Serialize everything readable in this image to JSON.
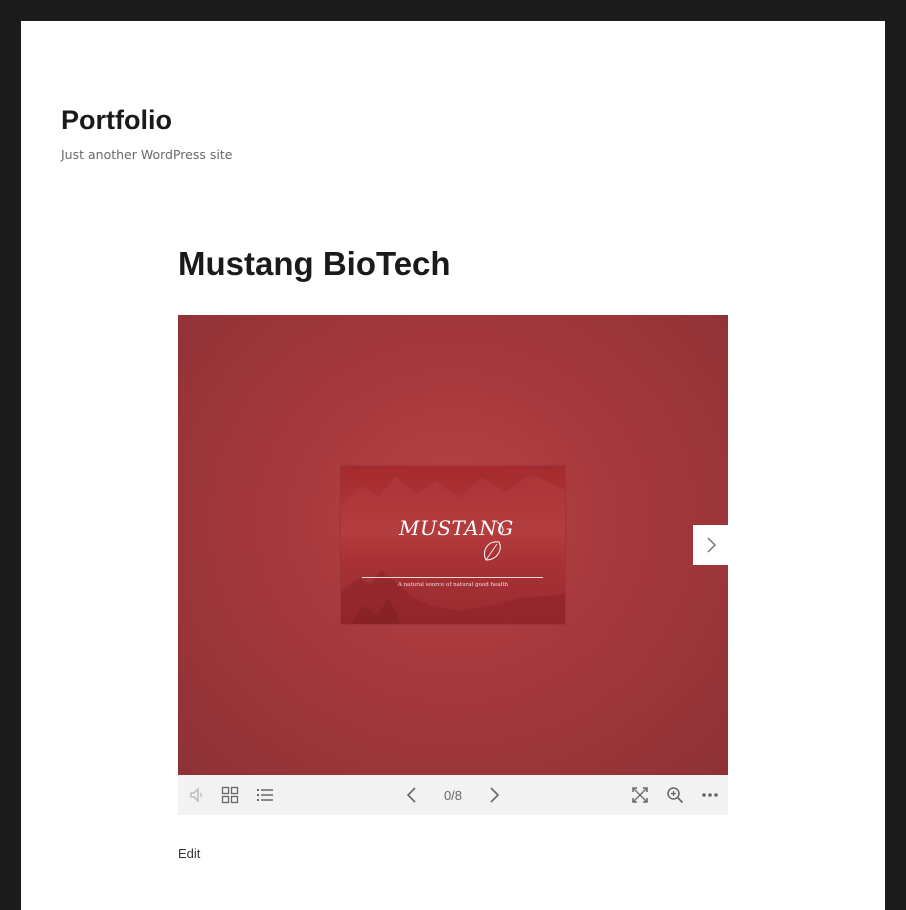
{
  "site": {
    "title": "Portfolio",
    "description": "Just another WordPress site"
  },
  "post": {
    "title": "Mustang BioTech",
    "edit_label": "Edit"
  },
  "viewer": {
    "slide": {
      "logo_text": "MUSTANG",
      "tagline": "A natural source of natural good health"
    },
    "counter": "0/8",
    "toolbar": {
      "left": [
        "speaker-icon",
        "grid-icon",
        "list-icon"
      ],
      "center": [
        "chevron-left-icon",
        "chevron-right-icon"
      ],
      "right": [
        "fullscreen-icon",
        "zoom-in-icon",
        "more-icon"
      ]
    }
  },
  "colors": {
    "page_bg": "#ffffff",
    "frame_bg": "#1b1b1b",
    "stage_red": "#a5383c",
    "toolbar_bg": "#f2f2f2",
    "icon_gray": "#666666"
  }
}
